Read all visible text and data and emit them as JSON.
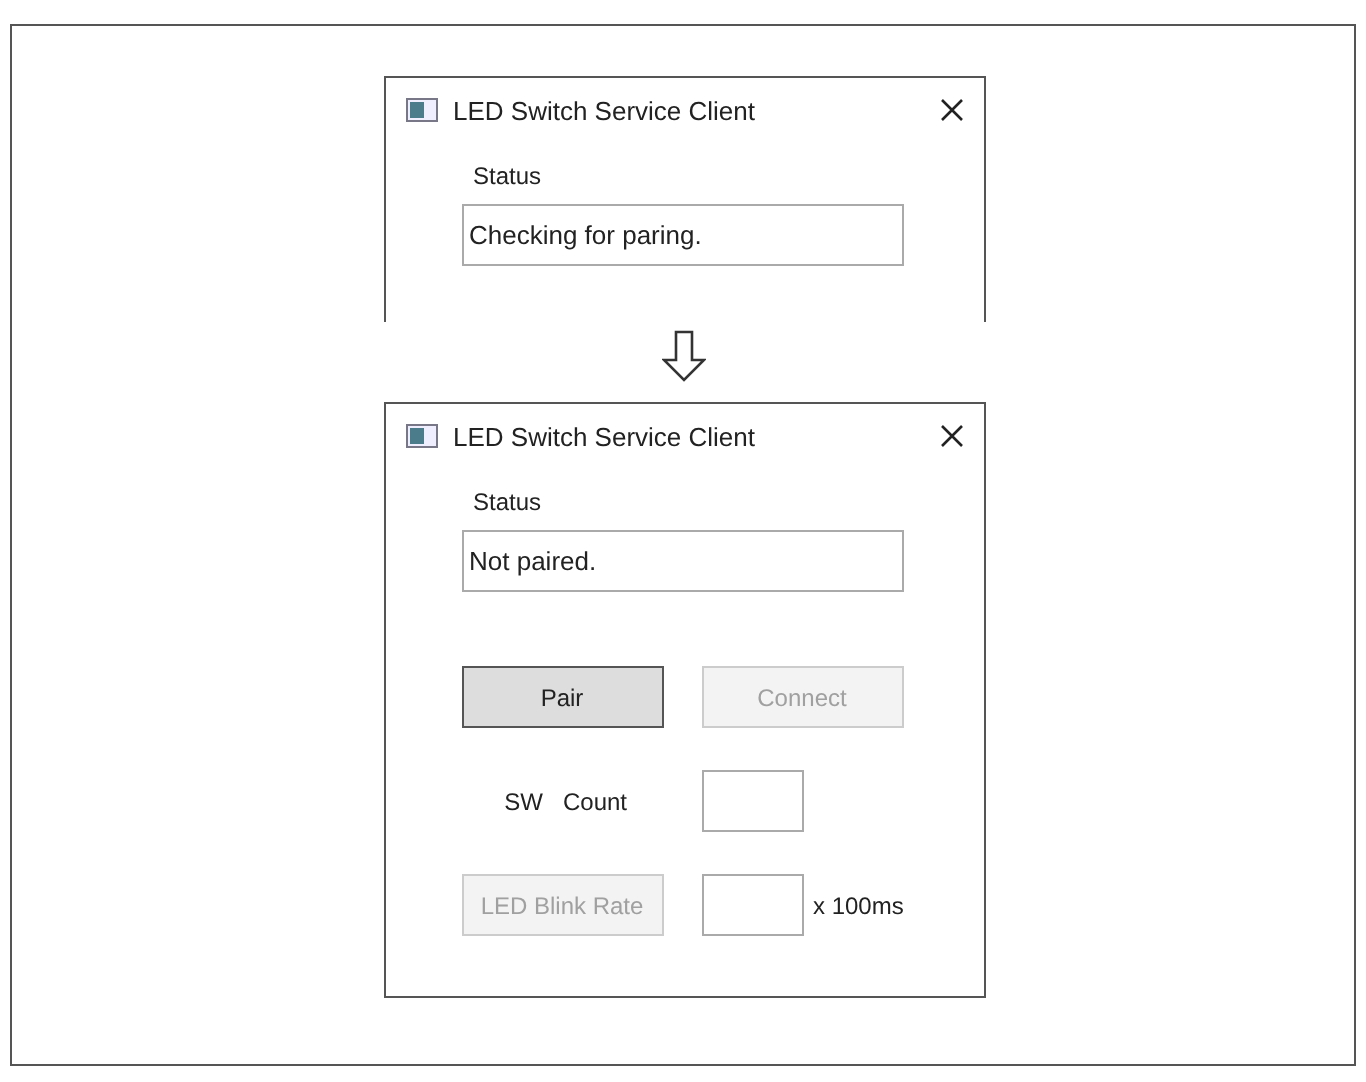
{
  "windows": [
    {
      "title": "LED Switch Service Client",
      "status_label": "Status",
      "status_value": "Checking for paring.",
      "cut_off": true
    },
    {
      "title": "LED Switch Service Client",
      "status_label": "Status",
      "status_value": "Not paired.",
      "cut_off": false,
      "buttons": [
        {
          "label": "Pair",
          "disabled": false
        },
        {
          "label": "Connect",
          "disabled": true
        }
      ],
      "sw_count_label": "SW   Count",
      "blink_button": {
        "label": "LED Blink Rate",
        "disabled": true
      },
      "blink_unit": "x 100ms"
    }
  ]
}
